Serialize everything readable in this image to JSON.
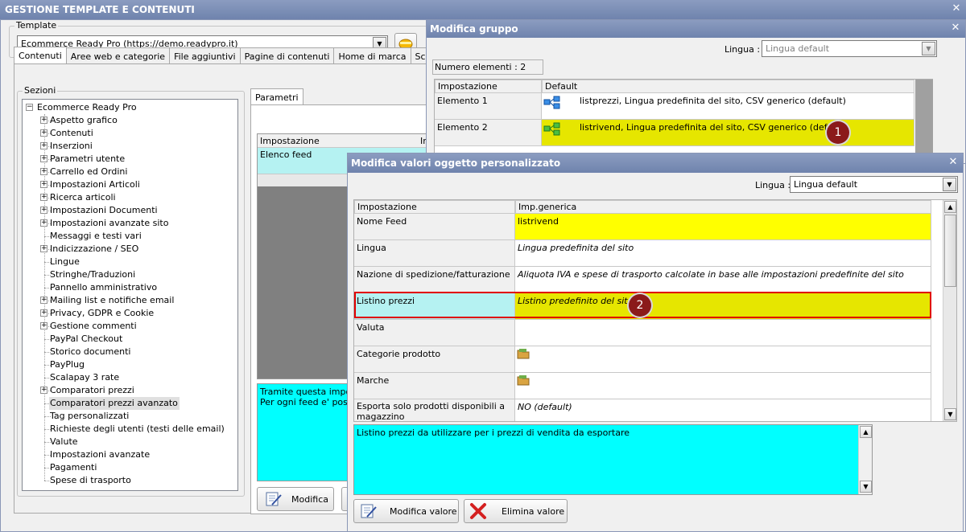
{
  "main_window": {
    "title": "GESTIONE TEMPLATE E CONTENUTI",
    "close": "✕"
  },
  "template": {
    "label": "Template",
    "value": "Ecommerce Ready Pro (https://demo.readypro.it)"
  },
  "tabs": [
    "Contenuti",
    "Aree web e categorie",
    "File aggiuntivi",
    "Pagine di contenuti",
    "Home di marca",
    "Sconti e mag"
  ],
  "sections": {
    "label": "Sezioni",
    "root": "Ecommerce Ready Pro",
    "items": [
      {
        "label": "Aspetto grafico",
        "expandable": true
      },
      {
        "label": "Contenuti",
        "expandable": true
      },
      {
        "label": "Inserzioni",
        "expandable": true
      },
      {
        "label": "Parametri utente",
        "expandable": true
      },
      {
        "label": "Carrello ed Ordini",
        "expandable": true
      },
      {
        "label": "Impostazioni Articoli",
        "expandable": true
      },
      {
        "label": "Ricerca articoli",
        "expandable": true
      },
      {
        "label": "Impostazioni Documenti",
        "expandable": true
      },
      {
        "label": "Impostazioni avanzate sito",
        "expandable": true
      },
      {
        "label": "Messaggi e testi vari",
        "expandable": false
      },
      {
        "label": "Indicizzazione / SEO",
        "expandable": true
      },
      {
        "label": "Lingue",
        "expandable": false
      },
      {
        "label": "Stringhe/Traduzioni",
        "expandable": false
      },
      {
        "label": "Pannello amministrativo",
        "expandable": false
      },
      {
        "label": "Mailing list e notifiche email",
        "expandable": true
      },
      {
        "label": "Privacy, GDPR e Cookie",
        "expandable": true
      },
      {
        "label": "Gestione commenti",
        "expandable": true
      },
      {
        "label": "PayPal Checkout",
        "expandable": false
      },
      {
        "label": "Storico documenti",
        "expandable": false
      },
      {
        "label": "PayPlug",
        "expandable": false
      },
      {
        "label": "Scalapay 3 rate",
        "expandable": false
      },
      {
        "label": "Comparatori prezzi",
        "expandable": true
      },
      {
        "label": "Comparatori prezzi avanzato",
        "expandable": false,
        "selected": true
      },
      {
        "label": "Tag personalizzati",
        "expandable": false
      },
      {
        "label": "Richieste degli utenti (testi delle email)",
        "expandable": false
      },
      {
        "label": "Valute",
        "expandable": false
      },
      {
        "label": "Impostazioni avanzate",
        "expandable": false
      },
      {
        "label": "Pagamenti",
        "expandable": false
      },
      {
        "label": "Spese di trasporto",
        "expandable": false
      }
    ]
  },
  "params_panel": {
    "tab": "Parametri",
    "col_header": "Impostazione",
    "col_header2": "Im",
    "row": "Elenco feed",
    "desc_line1": "Tramite questa impostaz",
    "desc_line2": "Per ogni feed e' possibil",
    "button_modifica": "Modifica"
  },
  "group_window": {
    "title": "Modifica gruppo",
    "close": "✕",
    "lang_label": "Lingua :",
    "lang_value": "Lingua default",
    "count": "Numero elementi : 2",
    "headers": [
      "Impostazione",
      "Default"
    ],
    "rows": [
      {
        "name": "Elemento 1",
        "value": "listprezzi, Lingua predefinita del sito, CSV generico (default)"
      },
      {
        "name": "Elemento 2",
        "value": "listrivend, Lingua predefinita del sito, CSV generico (default)"
      }
    ],
    "badge": "1"
  },
  "custom_window": {
    "title": "Modifica valori oggetto personalizzato",
    "close": "✕",
    "lang_label": "Lingua :",
    "lang_value": "Lingua default",
    "headers": [
      "Impostazione",
      "Imp.generica"
    ],
    "rows": [
      {
        "name": "Nome Feed",
        "value": "listrivend"
      },
      {
        "name": "Lingua",
        "value": "Lingua predefinita del sito"
      },
      {
        "name": "Nazione di spedizione/fatturazione",
        "value": "Aliquota IVA e spese di trasporto calcolate in base alle impostazioni predefinite del sito"
      },
      {
        "name": "Listino prezzi",
        "value": "Listino predefinito del sito"
      },
      {
        "name": "Valuta",
        "value": ""
      },
      {
        "name": "Categorie prodotto",
        "value": ""
      },
      {
        "name": "Marche",
        "value": ""
      },
      {
        "name": "Esportare solo prodotti disponibili a magazzino",
        "name_line1": "Esporta solo prodotti disponibili a",
        "name_line2": "magazzino",
        "value": "NO (default)"
      }
    ],
    "badge": "2",
    "description": "Listino prezzi da utilizzare per i prezzi di vendita da esportare",
    "btn_edit": "Modifica valore",
    "btn_delete": "Elimina valore"
  },
  "colors": {
    "highlight_yellow": "#ffff00",
    "selected_row": "#e6e600",
    "cyan": "#00ffff",
    "light_cyan": "#b5f2f2",
    "red_border": "#e00000"
  }
}
